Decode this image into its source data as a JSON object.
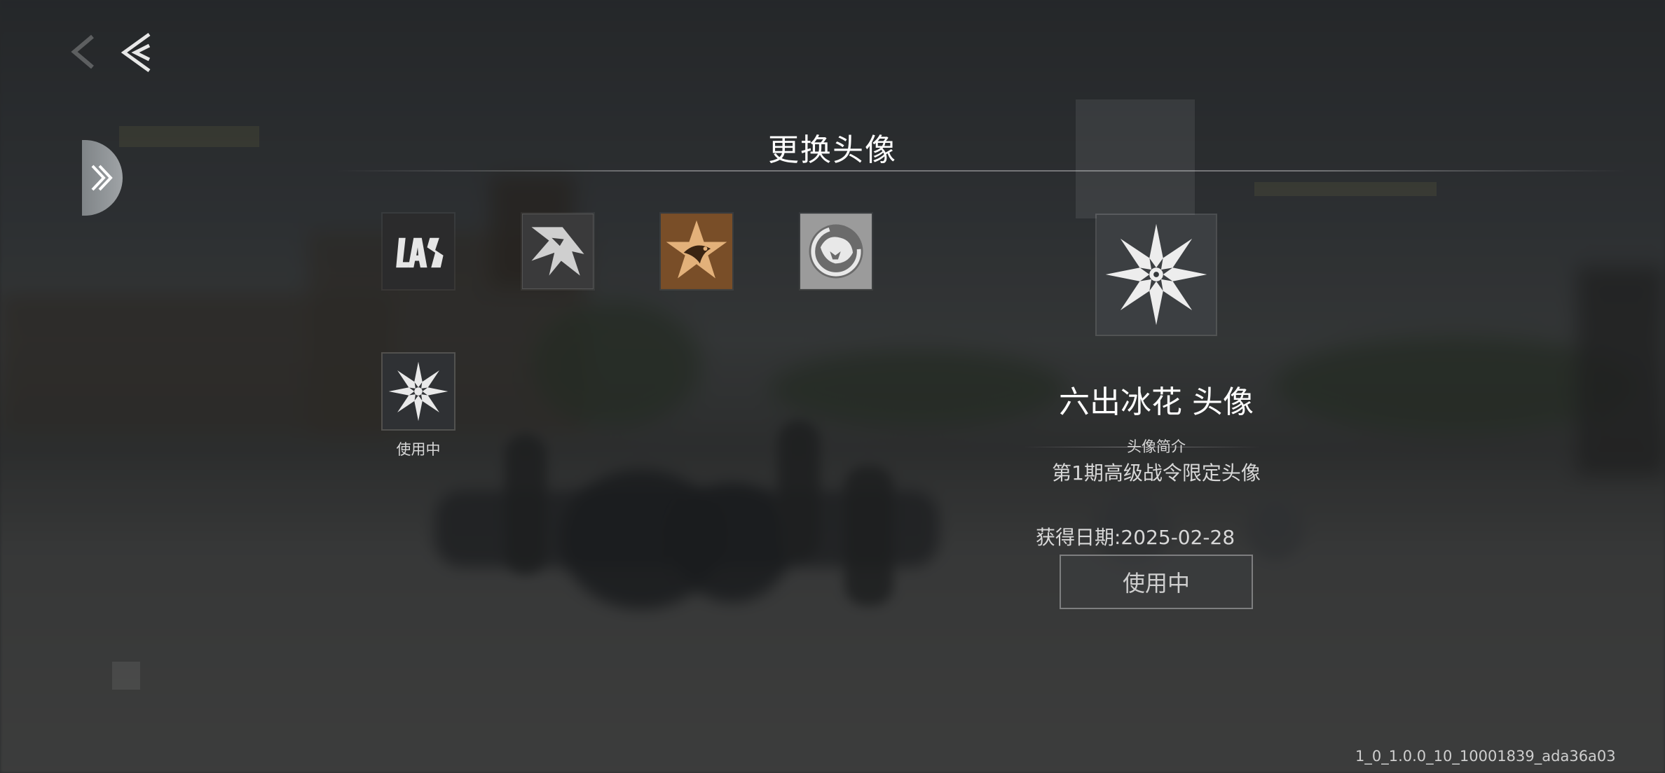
{
  "dialog": {
    "title": "更换头像"
  },
  "avatars": [
    {
      "name": "LAS emblem avatar",
      "icon": "las-emblem-icon",
      "selected": false
    },
    {
      "name": "wolf emblem avatar",
      "icon": "wolf-emblem-icon",
      "selected": false
    },
    {
      "name": "eagle star avatar",
      "icon": "eagle-star-icon",
      "selected": false
    },
    {
      "name": "bear emblem avatar",
      "icon": "bear-emblem-icon",
      "selected": false
    },
    {
      "name": "snowflake avatar",
      "icon": "snowflake-icon",
      "selected": true,
      "status": "使用中"
    }
  ],
  "detail": {
    "name": "六出冰花 头像",
    "intro_label": "头像简介",
    "intro_text": "第1期高级战令限定头像",
    "obtain_date": "获得日期:2025-02-28",
    "button_label": "使用中"
  },
  "version": "1_0_1.0.0_10_10001839_ada36a03",
  "colors": {
    "background_dim": "#2a2c2e",
    "text_primary": "#ffffff",
    "text_secondary": "#d8d8d8",
    "eagle_bg": "#8a5a2e"
  }
}
